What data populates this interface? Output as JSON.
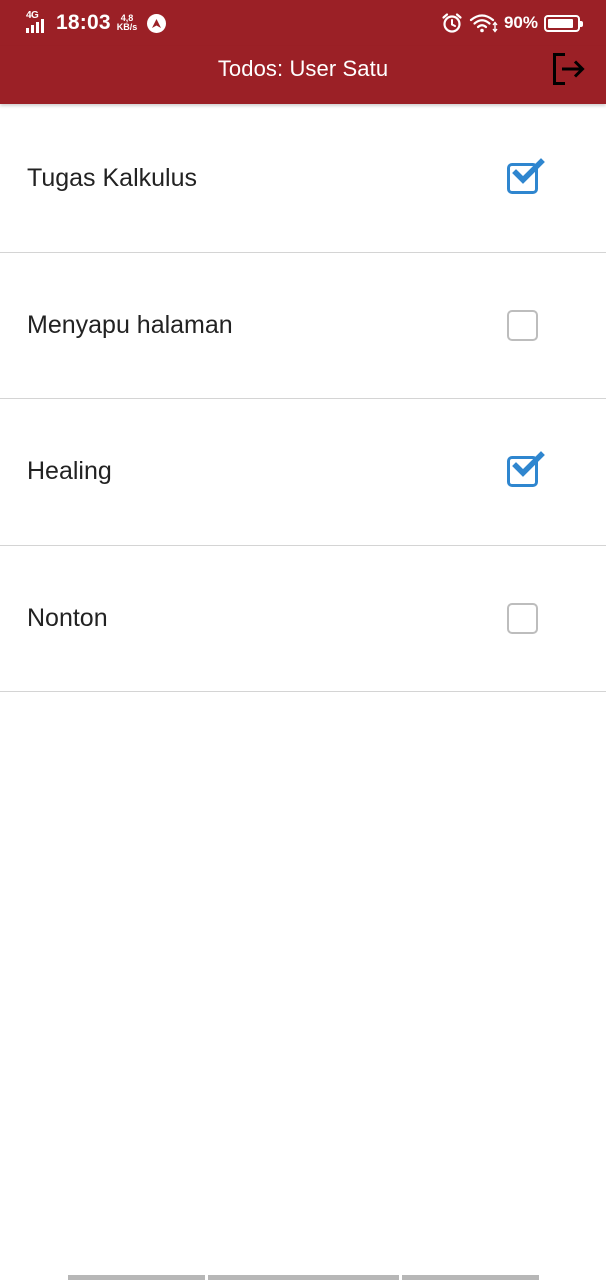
{
  "status_bar": {
    "network": "4G",
    "time": "18:03",
    "speed_value": "4,8",
    "speed_unit": "KB/s",
    "battery_percent": "90%",
    "battery_level": 0.9
  },
  "app_bar": {
    "title": "Todos: User Satu",
    "background_color": "#9b2026",
    "logout_icon": "logout-icon"
  },
  "todos": [
    {
      "title": "Tugas Kalkulus",
      "checked": true
    },
    {
      "title": "Menyapu halaman",
      "checked": false
    },
    {
      "title": "Healing",
      "checked": true
    },
    {
      "title": "Nonton",
      "checked": false
    }
  ],
  "colors": {
    "accent": "#2f86cf",
    "unchecked_border": "#bdbdbd",
    "divider": "#d4d4d4"
  }
}
